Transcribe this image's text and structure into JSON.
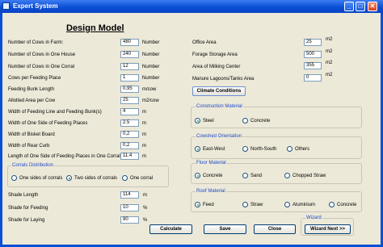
{
  "window": {
    "title": "Expert System",
    "minimize": "_",
    "maximize": "□",
    "close": "✕"
  },
  "heading": "Design Model",
  "left_fields": [
    {
      "label": "Number of Cows in Farm:",
      "value": "480",
      "unit": "Number"
    },
    {
      "label": "Number of Cows in One House",
      "value": "240",
      "unit": "Number"
    },
    {
      "label": "Number of Cows in One Corral",
      "value": "12",
      "unit": "Number"
    },
    {
      "label": "Cows per Feeding Place",
      "value": "1",
      "unit": "Number"
    },
    {
      "label": "Feeding Bunk Length",
      "value": "0,95",
      "unit": "m/cow"
    },
    {
      "label": "Allotted Area per Cow",
      "value": "25",
      "unit": "m2/cow"
    },
    {
      "label": "Width of Feeding Line and Feeding Bunk(s)",
      "value": "4",
      "unit": "m"
    },
    {
      "label": "Width of One Side of Feeding Places",
      "value": "2.5",
      "unit": "m"
    },
    {
      "label": "Width of Bisket Board",
      "value": "0,2",
      "unit": "m"
    },
    {
      "label": "Width of Rear Curb",
      "value": "0,2",
      "unit": "m"
    },
    {
      "label": "Length of One Side of Feeding Places in One Corral",
      "value": "11.4",
      "unit": "m"
    }
  ],
  "corrals": {
    "title": "Corrals Distribution",
    "options": [
      "One sides of corrals",
      "Two sides of corrals",
      "One corral"
    ],
    "selected_index": 1
  },
  "shade_fields": [
    {
      "label": "Shade Length",
      "value": "114",
      "unit": "m"
    },
    {
      "label": "Shade for Feeding",
      "value": "10",
      "unit": "%"
    },
    {
      "label": "Shade for Laying",
      "value": "90",
      "unit": "%"
    }
  ],
  "right_fields": [
    {
      "label": "Office Area",
      "value": "25",
      "unit": "m2"
    },
    {
      "label": "Forage Storage Area",
      "value": "500",
      "unit": "m2"
    },
    {
      "label": "Area of Milking Center",
      "value": "355",
      "unit": "m2"
    },
    {
      "label": "Manure Lagoons/Tanks Area",
      "value": "0",
      "unit": "m2"
    }
  ],
  "climate_button": "Climate Conditions",
  "groups": [
    {
      "title": "Construction Material",
      "options": [
        "Steel",
        "Concrete"
      ],
      "selected_index": 0
    },
    {
      "title": "Cowshed Orientation",
      "options": [
        "East-West",
        "North-South",
        "Others"
      ],
      "selected_index": 0
    },
    {
      "title": "Floor Material",
      "options": [
        "Concrete",
        "Sand",
        "Chopped Straw"
      ],
      "selected_index": 0
    },
    {
      "title": "Roof Material",
      "options": [
        "Feed",
        "Straw",
        "Aluminium",
        "Concrete"
      ],
      "selected_index": 0
    }
  ],
  "buttons": {
    "calculate": "Calculate",
    "save": "Save",
    "close": "Close"
  },
  "wizard": {
    "title": "Wizard",
    "button": "Wizard Next >>"
  }
}
